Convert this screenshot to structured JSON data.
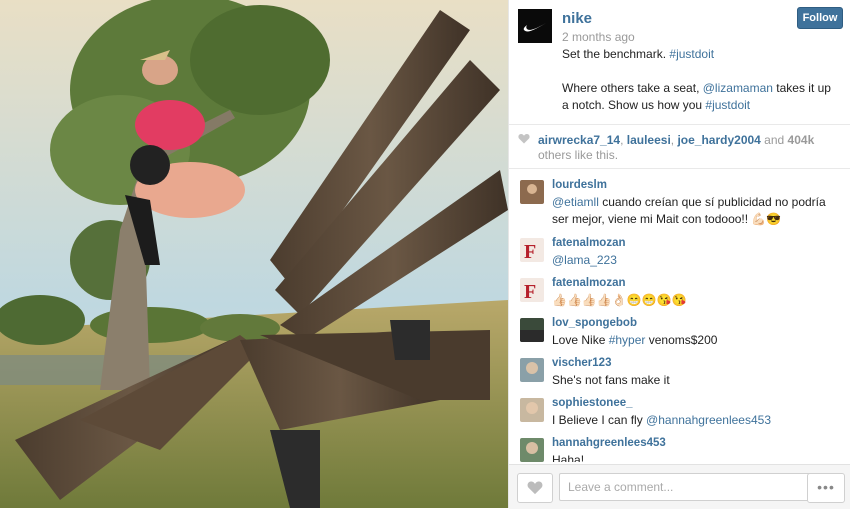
{
  "post": {
    "username": "nike",
    "time_ago": "2 months ago",
    "follow_label": "Follow",
    "caption_line1": "Set the benchmark. ",
    "caption_tag1": "#justdoit",
    "caption_line2a": "Where others take a seat, ",
    "caption_mention": "@lizamaman",
    "caption_line2b": " takes it up a notch. Show us how you ",
    "caption_tag2": "#justdoit"
  },
  "likes": {
    "user1": "airwrecka7_14",
    "user2": "lauleesi",
    "user3": "joe_hardy2004",
    "and_word": " and ",
    "count": "404k",
    "suffix": " others like this."
  },
  "comments": [
    {
      "user": "lourdeslm",
      "mention": "@etiamll",
      "text": " cuando creían que sí publicidad no podría ser mejor, viene mi Mait con todooo!! 💪🏻😎"
    },
    {
      "user": "fatenalmozan",
      "mention": "@lama_223",
      "text": ""
    },
    {
      "user": "fatenalmozan",
      "mention": "",
      "text": "👍🏻👍🏻👍🏻👍🏻👌🏻😁😁😘😘"
    },
    {
      "user": "lov_spongebob",
      "text_a": "Love Nike ",
      "tag": "#hyper",
      "text_b": " venoms$200"
    },
    {
      "user": "vischer123",
      "text": "She's not fans make it"
    },
    {
      "user": "sophiestonee_",
      "text_a": "I Believe I can fly ",
      "mention": "@hannahgreenlees453"
    },
    {
      "user": "hannahgreenlees453",
      "text": "Haha!"
    }
  ],
  "composer": {
    "placeholder": "Leave a comment...",
    "more_label": "•••"
  },
  "icons": {
    "logo": "nike-swoosh-logo",
    "like": "heart-icon",
    "more": "ellipsis-icon"
  },
  "colors": {
    "link": "#3f729b",
    "follow_bg": "#3f729b",
    "muted": "#9a9a9a"
  }
}
